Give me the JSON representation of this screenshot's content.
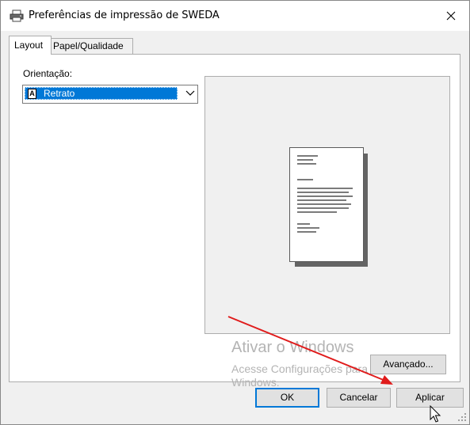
{
  "window": {
    "title": "Preferências de impressão de SWEDA"
  },
  "tabs": [
    {
      "label": "Layout",
      "active": true
    },
    {
      "label": "Papel/Qualidade",
      "active": false
    }
  ],
  "layout_tab": {
    "orientation_label": "Orientação:",
    "orientation_value": "Retrato",
    "orientation_icon_letter": "A"
  },
  "buttons": {
    "advanced": "Avançado...",
    "ok": "OK",
    "cancel": "Cancelar",
    "apply": "Aplicar"
  },
  "watermark": {
    "line1": "Ativar o Windows",
    "line2": "Acesse Configurações para ativar o Windows."
  },
  "annotation": {
    "arrow_color": "#e01b1b"
  },
  "colors": {
    "accent": "#0078d7",
    "selection": "#0078d7"
  },
  "icons": {
    "title": "printer-icon",
    "close": "close-icon",
    "dropdown": "chevron-down-icon",
    "orientation": "portrait-page-icon"
  }
}
